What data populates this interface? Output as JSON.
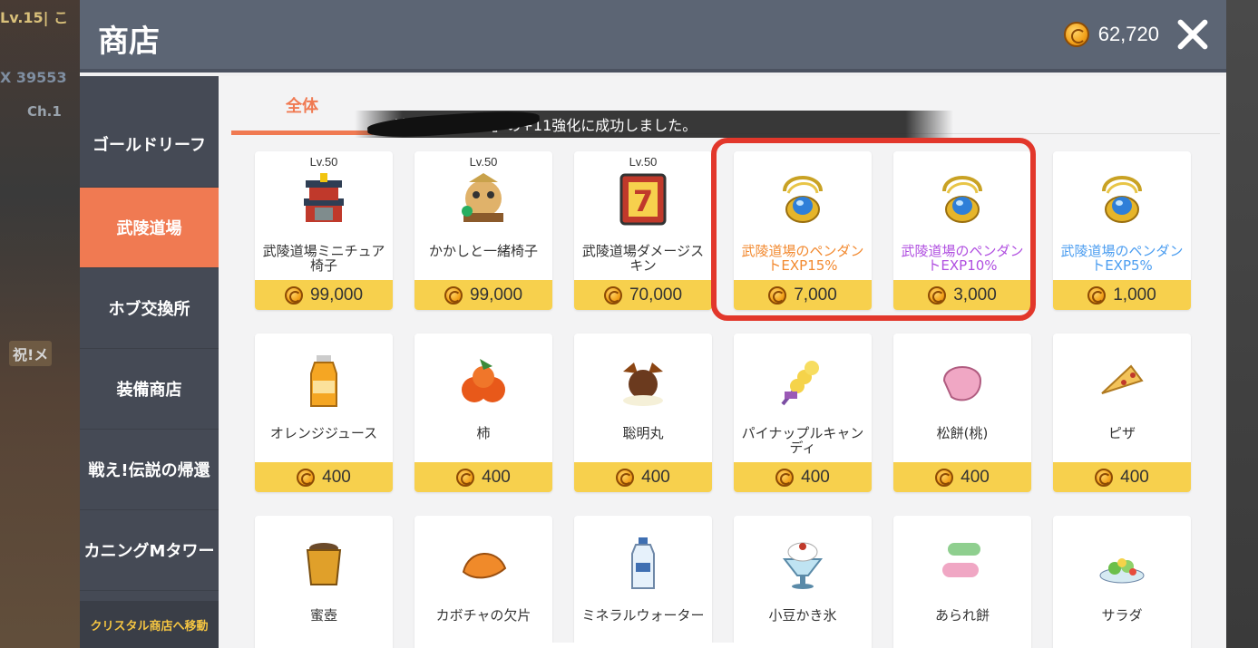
{
  "header": {
    "title": "商店",
    "coins": "62,720"
  },
  "background": {
    "lv_text": "Lv.15| こ",
    "exp_text": "X 39553",
    "ch_text": "Ch.1",
    "celebration": "祝!メ"
  },
  "sidebar": {
    "items": [
      {
        "label": "ゴールドリーフ",
        "active": false
      },
      {
        "label": "武陵道場",
        "active": true
      },
      {
        "label": "ホブ交換所",
        "active": false
      },
      {
        "label": "装備商店",
        "active": false
      },
      {
        "label": "戦え!伝説の帰還",
        "active": false
      },
      {
        "label": "カニングMタワー",
        "active": false
      }
    ],
    "crystal_link": "クリスタル商店へ移動"
  },
  "tabs": {
    "all": "全体"
  },
  "notice": {
    "text": "が「鉄ナックル」の+11強化に成功しました。"
  },
  "items": [
    {
      "lv": "Lv.50",
      "name": "武陵道場ミニチュア椅子",
      "price": "99,000",
      "icon": "dojo-tower-chair-icon",
      "color": "default"
    },
    {
      "lv": "Lv.50",
      "name": "かかしと一緒椅子",
      "price": "99,000",
      "icon": "scarecrow-chair-icon",
      "color": "default"
    },
    {
      "lv": "Lv.50",
      "name": "武陵道場ダメージスキン",
      "price": "70,000",
      "icon": "damage-skin-icon",
      "color": "default"
    },
    {
      "lv": "",
      "name": "武陵道場のペンダントEXP15%",
      "price": "7,000",
      "icon": "pendant-icon",
      "color": "orange"
    },
    {
      "lv": "",
      "name": "武陵道場のペンダントEXP10%",
      "price": "3,000",
      "icon": "pendant-icon",
      "color": "purple"
    },
    {
      "lv": "",
      "name": "武陵道場のペンダントEXP5%",
      "price": "1,000",
      "icon": "pendant-icon",
      "color": "blue"
    },
    {
      "lv": "",
      "name": "オレンジジュース",
      "price": "400",
      "icon": "orange-juice-icon",
      "color": "default"
    },
    {
      "lv": "",
      "name": "柿",
      "price": "400",
      "icon": "persimmon-icon",
      "color": "default"
    },
    {
      "lv": "",
      "name": "聡明丸",
      "price": "400",
      "icon": "pill-icon",
      "color": "default"
    },
    {
      "lv": "",
      "name": "パイナップルキャンディ",
      "price": "400",
      "icon": "pineapple-candy-icon",
      "color": "default"
    },
    {
      "lv": "",
      "name": "松餅(桃)",
      "price": "400",
      "icon": "songpyeon-icon",
      "color": "default"
    },
    {
      "lv": "",
      "name": "ピザ",
      "price": "400",
      "icon": "pizza-icon",
      "color": "default"
    },
    {
      "lv": "",
      "name": "蜜壺",
      "price": "",
      "icon": "honey-jar-icon",
      "color": "default"
    },
    {
      "lv": "",
      "name": "カボチャの欠片",
      "price": "",
      "icon": "pumpkin-piece-icon",
      "color": "default"
    },
    {
      "lv": "",
      "name": "ミネラルウォーター",
      "price": "",
      "icon": "water-bottle-icon",
      "color": "default"
    },
    {
      "lv": "",
      "name": "小豆かき氷",
      "price": "",
      "icon": "shaved-ice-icon",
      "color": "default"
    },
    {
      "lv": "",
      "name": "あられ餅",
      "price": "",
      "icon": "rice-cake-icon",
      "color": "default"
    },
    {
      "lv": "",
      "name": "サラダ",
      "price": "",
      "icon": "salad-icon",
      "color": "default"
    }
  ]
}
